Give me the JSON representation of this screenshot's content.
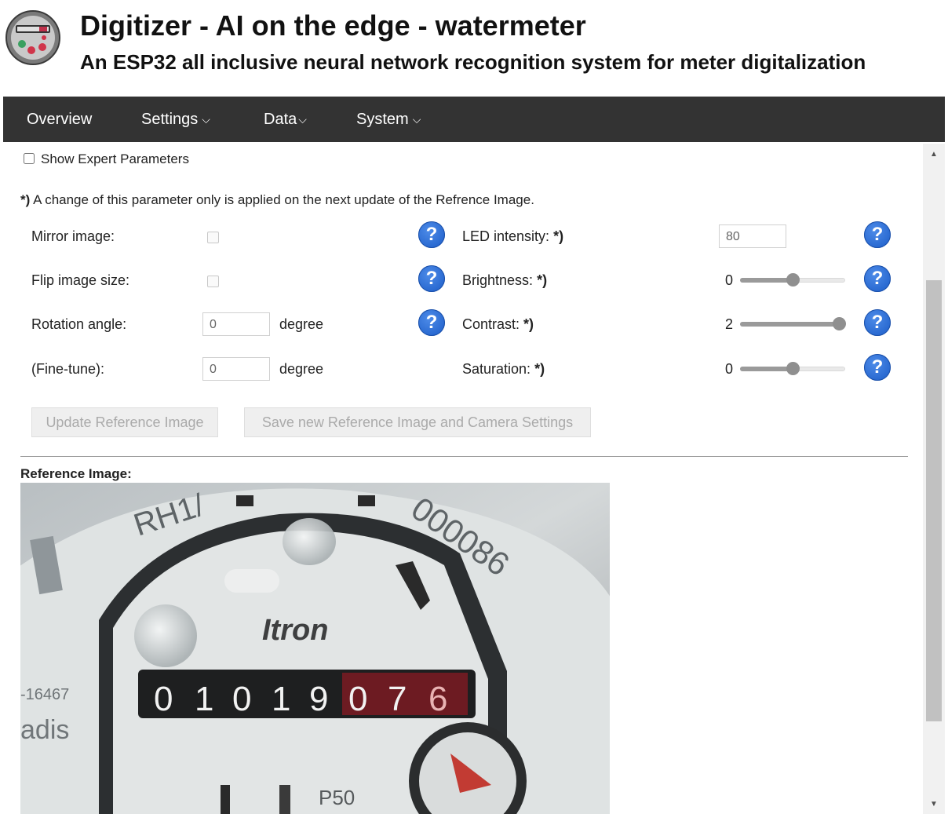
{
  "header": {
    "title": "Digitizer - AI on the edge - watermeter",
    "subtitle": "An ESP32 all inclusive neural network recognition system for meter digitalization"
  },
  "nav": [
    {
      "label": "Overview",
      "has_dropdown": false
    },
    {
      "label": "Settings",
      "has_dropdown": true
    },
    {
      "label": "Data",
      "has_dropdown": true
    },
    {
      "label": "System",
      "has_dropdown": true
    }
  ],
  "expert": {
    "label": "Show Expert Parameters",
    "checked": false
  },
  "note": {
    "prefix": "*)",
    "text": " A change of this parameter only is applied on the next update of the Refrence Image."
  },
  "params": {
    "mirror": {
      "label": "Mirror image:",
      "checked": false
    },
    "flip": {
      "label": "Flip image size:",
      "checked": false
    },
    "rotation": {
      "label": "Rotation angle:",
      "value": "0",
      "unit": "degree"
    },
    "finetune": {
      "label": "(Fine-tune):",
      "value": "0",
      "unit": "degree"
    },
    "led": {
      "label": "LED intensity:",
      "mark": "*)",
      "value": "80"
    },
    "brightness": {
      "label": "Brightness:",
      "mark": "*)",
      "value": "0",
      "min": -2,
      "max": 2
    },
    "contrast": {
      "label": "Contrast:",
      "mark": "*)",
      "value": "2",
      "min": -2,
      "max": 2
    },
    "saturation": {
      "label": "Saturation:",
      "mark": "*)",
      "value": "0",
      "min": -2,
      "max": 2
    }
  },
  "buttons": {
    "update": "Update Reference Image",
    "save": "Save new Reference Image and Camera Settings"
  },
  "reference": {
    "title": "Reference Image:",
    "meter_text": {
      "model": "RH1/",
      "serial": "000086",
      "brand": "Itron",
      "digits": [
        "0",
        "1",
        "0",
        "1",
        "9",
        "0",
        "7",
        "6"
      ],
      "side_number": "-16467",
      "side_word": "adis",
      "bottom_label": "P50"
    }
  },
  "colors": {
    "navbar": "#333333",
    "help_icon": "#1a5bc7",
    "button_disabled_text": "#aaaaaa"
  }
}
